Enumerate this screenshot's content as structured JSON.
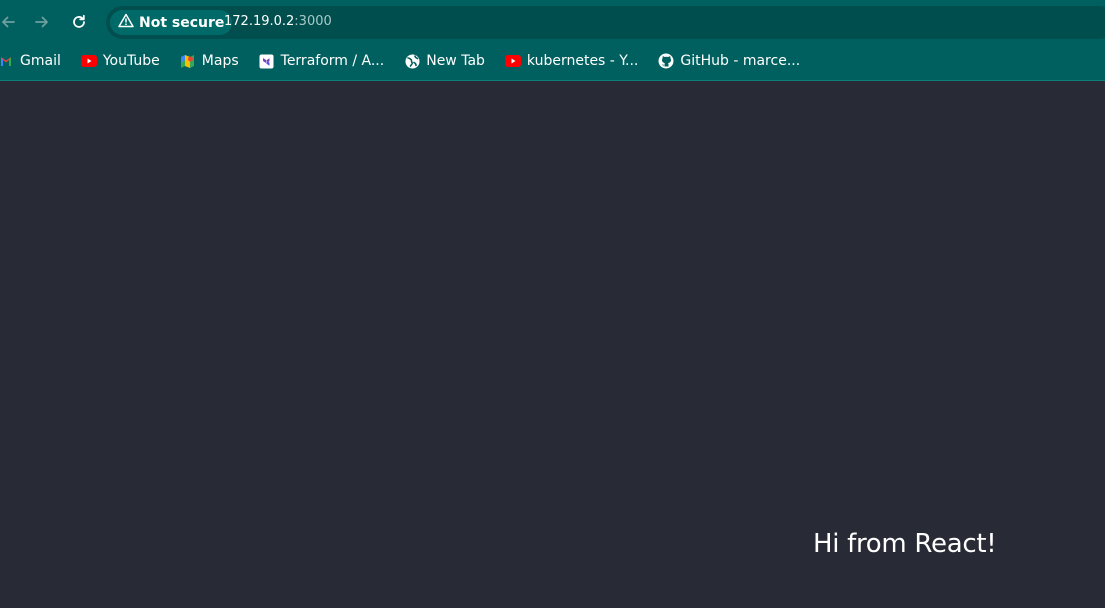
{
  "browser": {
    "security_label": "Not secure",
    "url_host": "172.19.0.2",
    "url_port": ":3000",
    "nav_icons": [
      "back-arrow-icon",
      "forward-arrow-icon",
      "reload-icon"
    ]
  },
  "bookmarks": [
    {
      "label": "Gmail",
      "icon": "gmail-icon"
    },
    {
      "label": "YouTube",
      "icon": "youtube-icon"
    },
    {
      "label": "Maps",
      "icon": "maps-icon"
    },
    {
      "label": "Terraform / A...",
      "icon": "terraform-icon"
    },
    {
      "label": "New Tab",
      "icon": "globe-icon"
    },
    {
      "label": "kubernetes - Y...",
      "icon": "youtube-icon"
    },
    {
      "label": "GitHub - marce...",
      "icon": "github-icon"
    }
  ],
  "page": {
    "greeting": "Hi from React!"
  },
  "colors": {
    "chrome_bg": "#00605f",
    "omnibox_bg": "#004f4e",
    "page_bg": "#282a35",
    "youtube_red": "#ff0000"
  }
}
